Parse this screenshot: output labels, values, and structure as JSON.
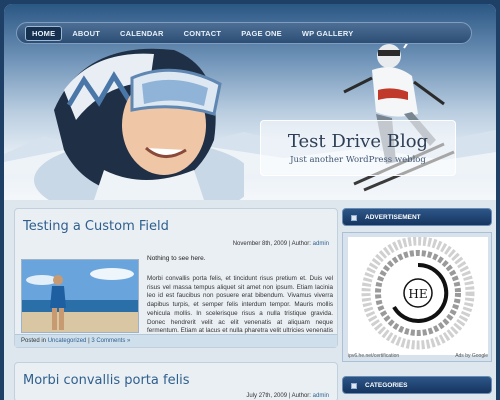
{
  "nav": {
    "items": [
      {
        "label": "HOME",
        "active": true
      },
      {
        "label": "ABOUT",
        "active": false
      },
      {
        "label": "CALENDAR",
        "active": false
      },
      {
        "label": "CONTACT",
        "active": false
      },
      {
        "label": "PAGE ONE",
        "active": false
      },
      {
        "label": "WP GALLERY",
        "active": false
      }
    ]
  },
  "blog": {
    "title": "Test Drive Blog",
    "tagline": "Just another WordPress weblog"
  },
  "posts": [
    {
      "title": "Testing a Custom Field",
      "date": "November 8th, 2009",
      "author_prefix": "| Author:",
      "author": "admin",
      "lead": "Nothing to see here.",
      "excerpt": "Morbi convallis porta felis, et tincidunt risus pretium et. Duis vel risus vel massa tempus aliquet sit amet non ipsum. Etiam lacinia leo id est faucibus non posuere erat bibendum. Vivamus viverra dapibus turpis, et semper felis interdum tempor. Mauris mollis vehicula mollis. In scelerisque risus a nulla tristique gravida. Donec hendrerit velit ac elit venenatis at aliquam neque fermentum. Etiam at lacus et nulla pharetra velit ultricies venenatis placerat sit amet felis. Praesent convallis, ipsum non elementum.",
      "footer_prefix": "Posted in",
      "category": "Uncategorized",
      "comments": "3 Comments »"
    },
    {
      "title": "Morbi convallis porta felis",
      "date": "July 27th, 2009",
      "author_prefix": "| Author:",
      "author": "admin"
    }
  ],
  "sidebar": {
    "advertisement": "ADVERTISEMENT",
    "ad_logo": "HE",
    "ad_url": "ipv6.he.net/certification",
    "ad_by": "Ads by Google",
    "categories": "CATEGORIES"
  },
  "colors": {
    "accent": "#2f5f8d",
    "nav_bg": "#2d4e74",
    "page_bg": "#1e3f66"
  }
}
